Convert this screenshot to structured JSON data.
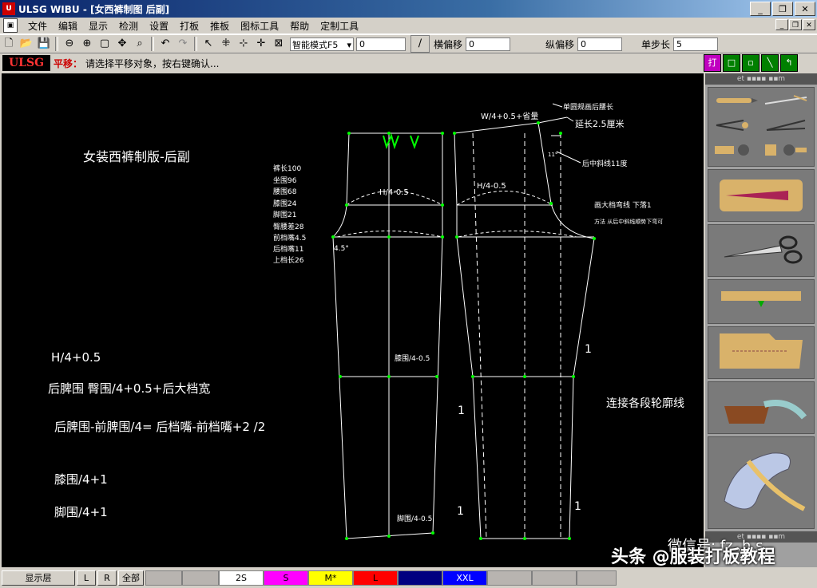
{
  "window": {
    "title": "ULSG WIBU - [女西裤制图 后副]",
    "app_icon": "U",
    "buttons": [
      "_",
      "❐",
      "✕"
    ],
    "mdi_buttons": [
      "_",
      "❐",
      "✕"
    ]
  },
  "menu": [
    "文件",
    "编辑",
    "显示",
    "检测",
    "设置",
    "打板",
    "推板",
    "图标工具",
    "帮助",
    "定制工具"
  ],
  "toolbar": {
    "mode_select": "智能模式F5",
    "value_field": "0",
    "h_offset_label": "横偏移",
    "h_offset_value": "0",
    "v_offset_label": "纵偏移",
    "v_offset_value": "0",
    "step_label": "单步长",
    "step_value": "5"
  },
  "status": {
    "logo": "ULSG",
    "command": "平移：",
    "prompt": "请选择平移对象，按右键确认..."
  },
  "right_toolbar": [
    "打",
    "□",
    "▫",
    "╲",
    "↰"
  ],
  "right_panel_header": "et ▪▪▪▪ ▪▪m",
  "drawing": {
    "title": "女装西裤制版-后副",
    "measurements": [
      "裤长100",
      "坐围96",
      "腰围68",
      "膝围24",
      "脚围21",
      "臀腰差28",
      "前档嘴4.5",
      "后档嘴11",
      "上档长26"
    ],
    "formulas": [
      "H/4+0.5",
      "后脾围    臀围/4+0.5+后大档宽",
      "后脾围-前脾围/4=    后档嘴-前档嘴+2    /2",
      "膝围/4+1",
      "脚围/4+1"
    ],
    "labels": {
      "front_h": "H/4-0.5",
      "back_h": "H/4-0.5",
      "angle": "4.5°",
      "knee": "膝围/4-0.5",
      "hem": "脚围/4-0.5",
      "waist_formula": "W/4+0.5+省量",
      "waist_note": "单圆规画后腰长",
      "extend": "延长2.5厘米",
      "slant": "后中斜线11度",
      "slant_small": "11°",
      "crotch_curve": "画大档弯线    下落1",
      "method": "方法   从后中斜线顺势下弯可",
      "connect": "连接各段轮廓线",
      "one": "1"
    }
  },
  "bottom": {
    "layer_button": "显示层",
    "l": "L",
    "r": "R",
    "all": "全部",
    "sizes": [
      {
        "label": "",
        "color": "#b8b4b0"
      },
      {
        "label": "2S",
        "color": "#ffffff"
      },
      {
        "label": "S",
        "color": "#ff00ff"
      },
      {
        "label": "M*",
        "color": "#ffff00"
      },
      {
        "label": "L",
        "color": "#ff0000"
      },
      {
        "label": "",
        "color": "#000080"
      },
      {
        "label": "XXL",
        "color": "#0000ff"
      },
      {
        "label": "",
        "color": "#b8b4b0"
      },
      {
        "label": "",
        "color": "#b8b4b0"
      },
      {
        "label": "",
        "color": "#b8b4b0"
      },
      {
        "label": "",
        "color": "#b8b4b0"
      }
    ]
  },
  "watermark": {
    "line1": "微信号: fz..h.s",
    "line2": "头条 @服装打板教程"
  }
}
